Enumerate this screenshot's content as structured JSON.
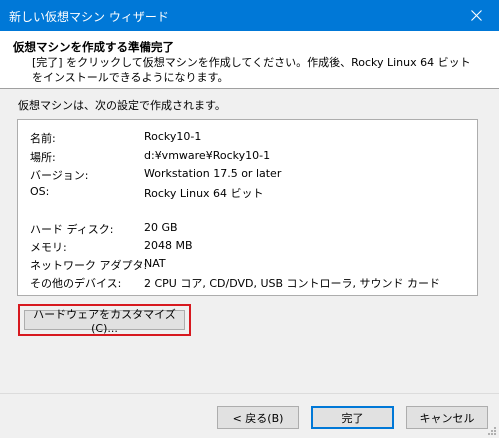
{
  "window": {
    "title": "新しい仮想マシン ウィザード",
    "close_symbol": "✕"
  },
  "header": {
    "title": "仮想マシンを作成する準備完了",
    "description": "[完了] をクリックして仮想マシンを作成してください。作成後、Rocky Linux 64 ビット をインストールできるようになります。"
  },
  "summary": {
    "lead": "仮想マシンは、次の設定で作成されます。",
    "items": [
      {
        "label": "名前:",
        "value": "Rocky10-1"
      },
      {
        "label": "場所:",
        "value": "d:¥vmware¥Rocky10-1"
      },
      {
        "label": "バージョン:",
        "value": "Workstation 17.5 or later"
      },
      {
        "label": "OS:",
        "value": "Rocky Linux 64 ビット"
      },
      {
        "label": "ハード ディスク:",
        "value": "20 GB"
      },
      {
        "label": "メモリ:",
        "value": "2048 MB"
      },
      {
        "label": "ネットワーク アダプタ:",
        "value": "NAT"
      },
      {
        "label": "その他のデバイス:",
        "value": "2 CPU コア, CD/DVD, USB コントローラ, サウンド カード"
      }
    ]
  },
  "buttons": {
    "customize": "ハードウェアをカスタマイズ(C)...",
    "back": "< 戻る(B)",
    "finish": "完了",
    "cancel": "キャンセル"
  },
  "colors": {
    "titlebar": "#0078d7",
    "highlight": "#d7191f"
  }
}
